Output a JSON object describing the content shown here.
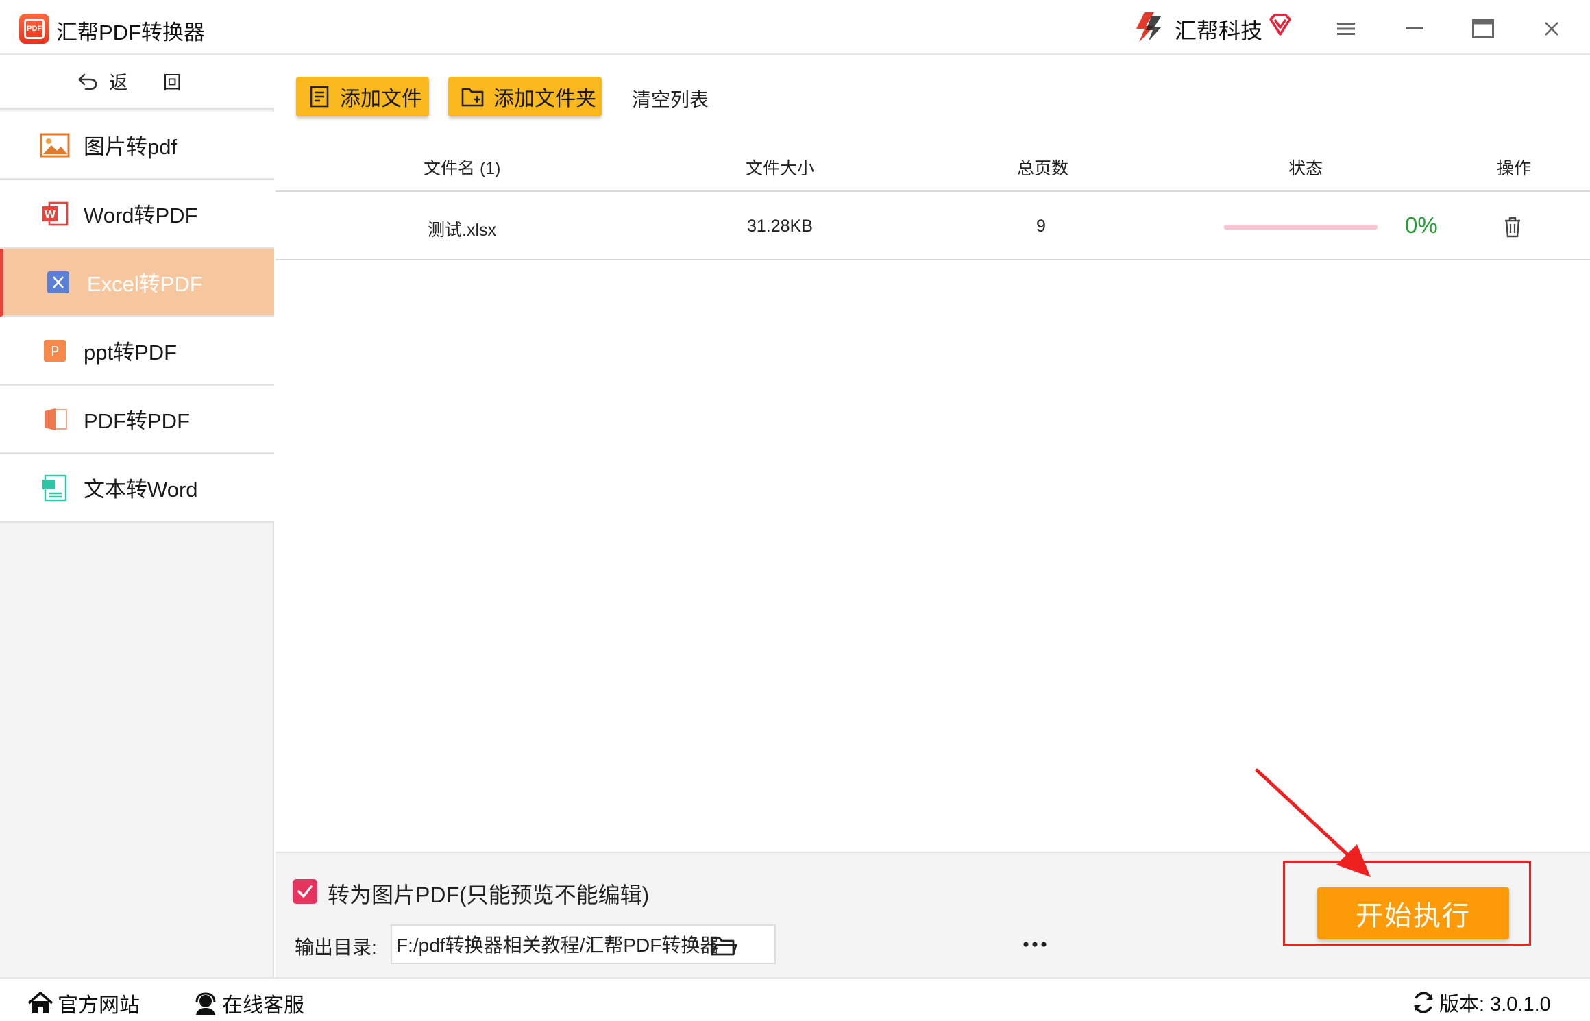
{
  "app": {
    "title": "汇帮PDF转换器",
    "logo_text": "PDF",
    "brand_name": "汇帮科技"
  },
  "sidebar": {
    "back_label": "返 回",
    "items": [
      {
        "label": "图片转pdf",
        "icon": "image-icon",
        "active": false
      },
      {
        "label": "Word转PDF",
        "icon": "word-icon",
        "active": false
      },
      {
        "label": "Excel转PDF",
        "icon": "excel-icon",
        "active": true
      },
      {
        "label": "ppt转PDF",
        "icon": "ppt-icon",
        "active": false
      },
      {
        "label": "PDF转PDF",
        "icon": "pdf-icon",
        "active": false
      },
      {
        "label": "文本转Word",
        "icon": "text-icon",
        "active": false
      }
    ]
  },
  "toolbar": {
    "add_file": "添加文件",
    "add_folder": "添加文件夹",
    "clear_list": "清空列表"
  },
  "table": {
    "headers": {
      "name": "文件名 (1)",
      "size": "文件大小",
      "pages": "总页数",
      "status": "状态",
      "action": "操作"
    },
    "rows": [
      {
        "name": "测试.xlsx",
        "size": "31.28KB",
        "pages": "9",
        "progress_text": "0%",
        "progress": 0
      }
    ]
  },
  "options": {
    "image_pdf_label": "转为图片PDF(只能预览不能编辑)",
    "image_pdf_checked": true,
    "output_label": "输出目录:",
    "output_path": "F:/pdf转换器相关教程/汇帮PDF转换器"
  },
  "start_button": "开始执行",
  "status": {
    "website": "官方网站",
    "support": "在线客服",
    "version": "版本: 3.0.1.0"
  },
  "colors": {
    "accent_yellow": "#f9b81e",
    "start_orange": "#fd9a08",
    "active_nav": "#f7c8a0",
    "progress_green": "#20a030",
    "annotation_red": "#ee2020"
  }
}
